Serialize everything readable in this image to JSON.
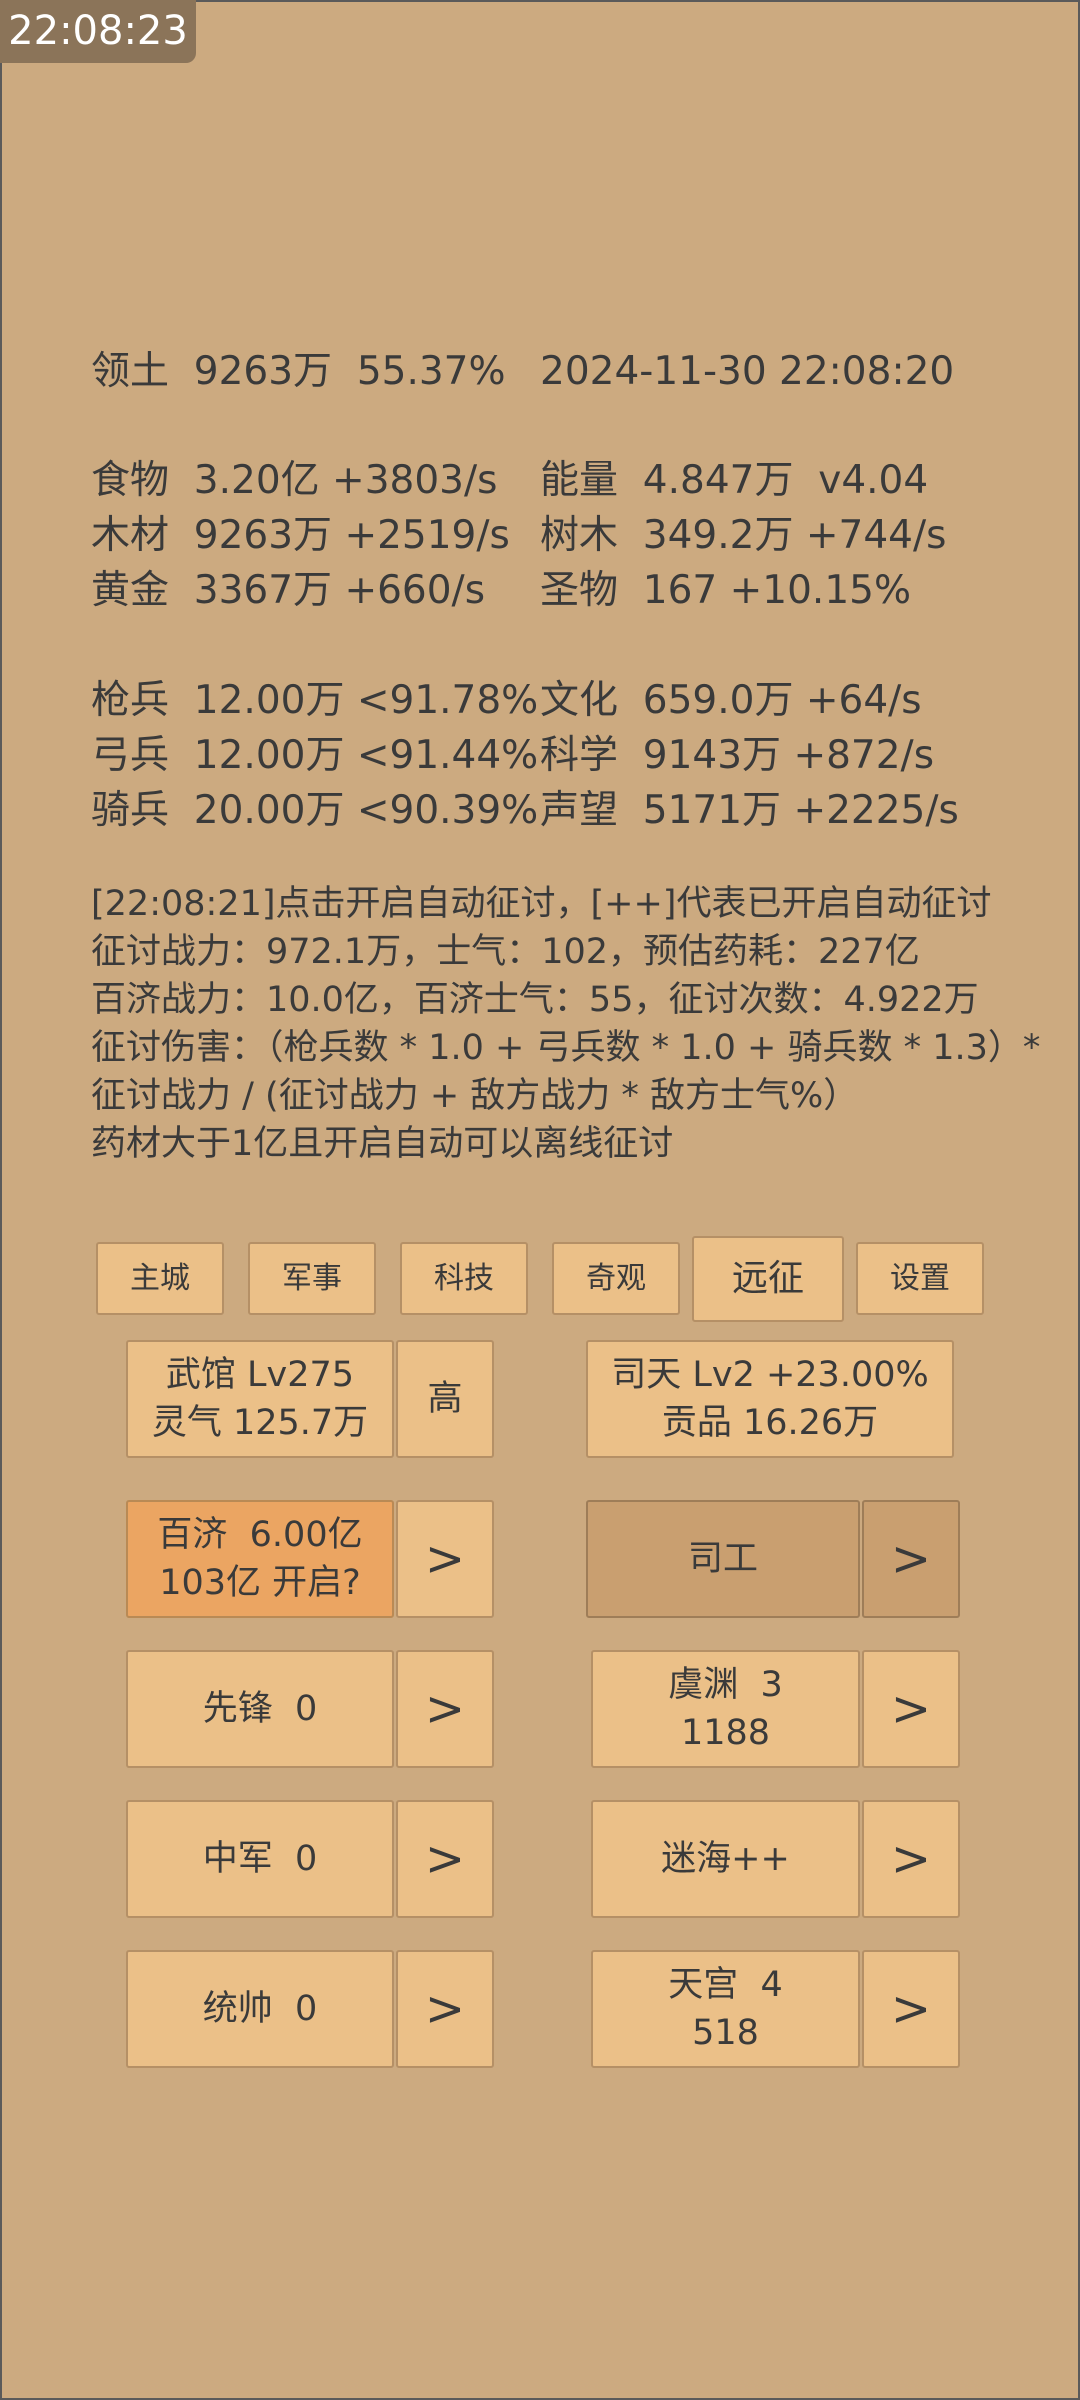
{
  "status_clock": "22:08:23",
  "stats": {
    "row1": "领土  9263万  55.37%",
    "datetime": "2024-11-30 22:08:20",
    "left": [
      "食物  3.20亿 +3803/s",
      "木材  9263万 +2519/s",
      "黄金  3367万 +660/s",
      "枪兵  12.00万 <91.78%",
      "弓兵  12.00万 <91.44%",
      "骑兵  20.00万 <90.39%"
    ],
    "right": [
      "能量  4.847万  v4.04",
      "树木  349.2万 +744/s",
      "圣物  167 +10.15%",
      "文化  659.0万 +64/s",
      "科学  9143万 +872/s",
      "声望  5171万 +2225/s"
    ]
  },
  "log_lines": [
    "[22:08:21]点击开启自动征讨，[++]代表已开启自动征讨",
    "征讨战力：972.1万，士气：102，预估药耗：227亿",
    "百济战力：10.0亿，百济士气：55，征讨次数：4.922万",
    "征讨伤害：（枪兵数 * 1.0 + 弓兵数 * 1.0 + 骑兵数 * 1.3）*",
    "征讨战力 / (征讨战力 + 敌方战力 * 敌方士气%）",
    "药材大于1亿且开启自动可以离线征讨"
  ],
  "tabs": [
    "主城",
    "军事",
    "科技",
    "奇观",
    "远征",
    "设置"
  ],
  "active_tab": "远征",
  "wuguan": {
    "line1": "武馆 Lv275",
    "line2": "灵气 125.7万",
    "side": "高"
  },
  "sitian": {
    "line1": "司天 Lv2 +23.00%",
    "line2": "贡品 16.26万"
  },
  "arrow": ">",
  "left_buttons": [
    {
      "line1": "百济  6.00亿",
      "line2": "103亿 开启?"
    },
    {
      "line1": "先锋  0"
    },
    {
      "line1": "中军  0"
    },
    {
      "line1": "统帅  0"
    }
  ],
  "right_buttons": [
    {
      "line1": "司工"
    },
    {
      "line1": "虞渊  3",
      "line2": "1188"
    },
    {
      "line1": "迷海++"
    },
    {
      "line1": "天宫  4",
      "line2": "518"
    }
  ],
  "colors": {
    "background": "#ccaa80",
    "button": "#ebc088",
    "button_highlight": "#eba562",
    "button_pressed": "#c99f70",
    "clock_bg": "#8b7459"
  }
}
